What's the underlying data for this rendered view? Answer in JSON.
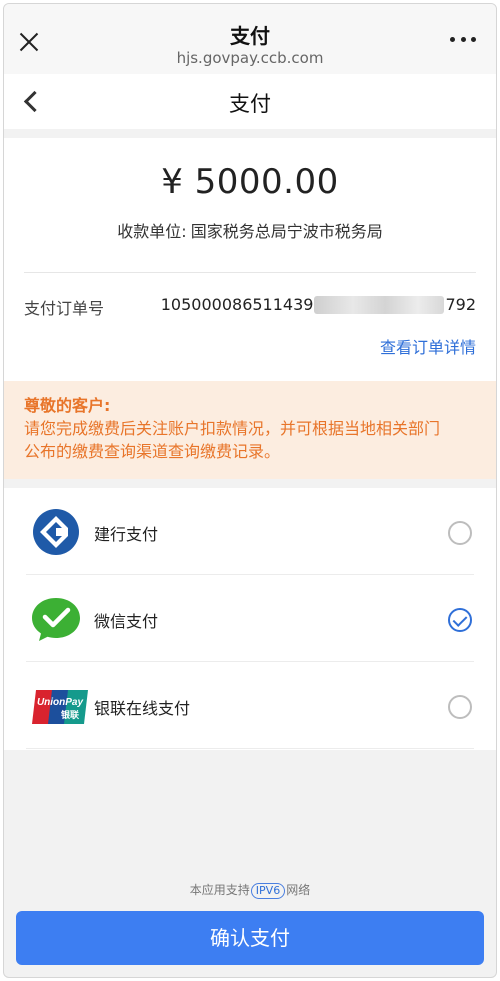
{
  "browser": {
    "title": "支付",
    "url": "hjs.govpay.ccb.com"
  },
  "header": {
    "title": "支付"
  },
  "payment": {
    "amount": "¥ 5000.00",
    "payee_label": "收款单位:",
    "payee_value": "国家税务总局宁波市税务局",
    "order_label": "支付订单号",
    "order_prefix": "105000086511439",
    "order_suffix": "792",
    "order_detail_link": "查看订单详情"
  },
  "notice": {
    "title": "尊敬的客户:",
    "lines": [
      "请您完成缴费后关注账户扣款情况，并可根据当地相关部门",
      "公布的缴费查询渠道查询缴费记录。"
    ]
  },
  "methods": [
    {
      "label": "建行支付",
      "icon": "ccb-icon",
      "checked": false
    },
    {
      "label": "微信支付",
      "icon": "wechat-icon",
      "checked": true
    },
    {
      "label": "银联在线支付",
      "icon": "unionpay-icon",
      "checked": false
    }
  ],
  "unionpay_logo": {
    "top": "UnionPay",
    "bottom": "银联"
  },
  "footer": {
    "ipv6_prefix": "本应用支持",
    "ipv6_badge": "IPV6",
    "ipv6_suffix": "网络",
    "confirm_label": "确认支付"
  },
  "colors": {
    "accent": "#3d7ef2",
    "notice_text": "#e8752a",
    "notice_bg": "#fcede0",
    "ccb_blue": "#1f5aa8",
    "wechat_green": "#3cb034"
  }
}
